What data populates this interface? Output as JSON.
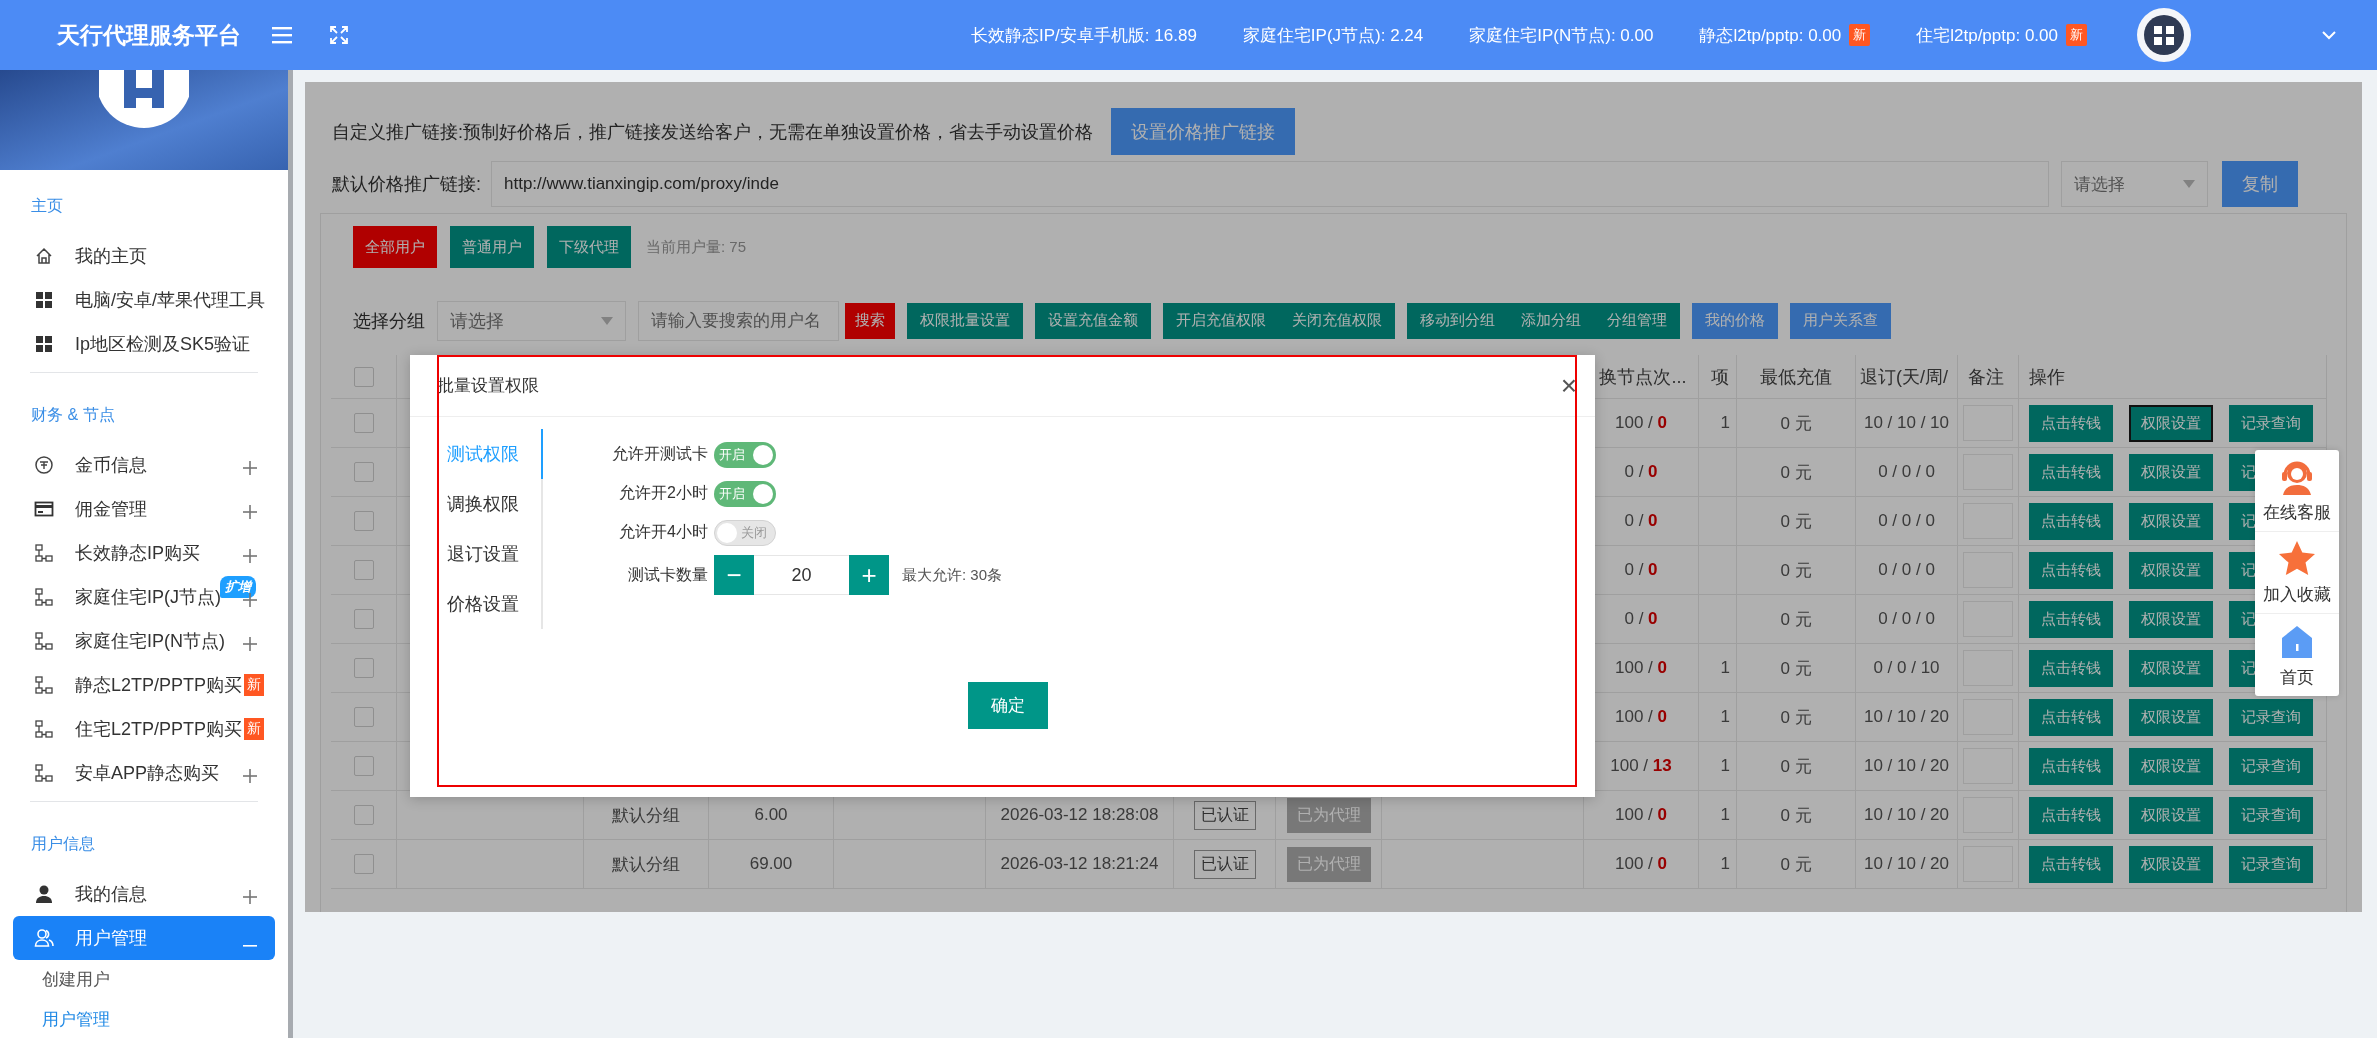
{
  "topbar": {
    "title": "天行代理服务平台",
    "stats": [
      {
        "label": "长效静态IP/安卓手机版: 16.89"
      },
      {
        "label": "家庭住宅IP(J节点): 2.24"
      },
      {
        "label": "家庭住宅IP(N节点): 0.00"
      },
      {
        "label": "静态l2tp/pptp: 0.00",
        "badge": "新"
      },
      {
        "label": "住宅l2tp/pptp: 0.00",
        "badge": "新"
      }
    ]
  },
  "sidebar": {
    "sections": [
      {
        "title": "主页",
        "items": [
          {
            "label": "我的主页",
            "selected": false
          },
          {
            "label": "电脑/安卓/苹果代理工具",
            "selected": false
          },
          {
            "label": "Ip地区检测及SK5验证",
            "selected": false
          }
        ]
      },
      {
        "title": "财务 & 节点",
        "items": [
          {
            "label": "金币信息",
            "selected": false,
            "expanded": false
          },
          {
            "label": "佣金管理",
            "selected": false,
            "expanded": false
          },
          {
            "label": "长效静态IP购买",
            "selected": false,
            "expanded": false
          },
          {
            "label": "家庭住宅IP(J节点)",
            "selected": false,
            "expanded": false,
            "badge": {
              "text": "扩增",
              "color": "#1e9fff"
            }
          },
          {
            "label": "家庭住宅IP(N节点)",
            "selected": false,
            "expanded": false
          },
          {
            "label": "静态L2TP/PPTP购买",
            "selected": false,
            "badge": {
              "text": "新",
              "color": "#ff5722"
            }
          },
          {
            "label": "住宅L2TP/PPTP购买",
            "selected": false,
            "badge": {
              "text": "新",
              "color": "#ff5722"
            }
          },
          {
            "label": "安卓APP静态购买",
            "selected": false,
            "expanded": false
          }
        ]
      },
      {
        "title": "用户信息",
        "items": [
          {
            "label": "我的信息",
            "selected": false,
            "expanded": false
          },
          {
            "label": "用户管理",
            "selected": true,
            "expanded": true,
            "children": [
              {
                "label": "创建用户",
                "selected": false
              },
              {
                "label": "用户管理",
                "selected": true
              }
            ]
          }
        ]
      }
    ]
  },
  "main": {
    "promo_text": "自定义推广链接:预制好价格后，推广链接发送给客户，无需在单独设置价格，省去手动设置价格",
    "promo_button": "设置价格推广链接",
    "link_label": "默认价格推广链接:",
    "link_value": "http://www.tianxingip.com/proxy/inde",
    "link_select": "请选择",
    "copy_button": "复制",
    "filters": [
      {
        "label": "全部用户",
        "selected": true
      },
      {
        "label": "普通用户",
        "selected": false
      },
      {
        "label": "下级代理",
        "selected": false
      }
    ],
    "user_count": "当前用户量: 75",
    "group_label": "选择分组",
    "group_select": "请选择",
    "search_placeholder": "请输入要搜索的用户名",
    "search_button": "搜索",
    "action_groups": [
      {
        "kind": "primary",
        "buttons": [
          "权限批量设置"
        ]
      },
      {
        "kind": "primary",
        "buttons": [
          "设置充值金额"
        ]
      },
      {
        "kind": "primary",
        "buttons": [
          "开启充值权限",
          "关闭充值权限"
        ]
      },
      {
        "kind": "primary",
        "buttons": [
          "移动到分组",
          "添加分组",
          "分组管理"
        ]
      },
      {
        "kind": "info",
        "buttons": [
          "我的价格"
        ]
      },
      {
        "kind": "info",
        "buttons": [
          "用户关系查"
        ]
      }
    ]
  },
  "table": {
    "select_all": false,
    "columns": [
      {
        "kind": "swap",
        "label": "换节点次..."
      },
      {
        "kind": "project",
        "label": "项"
      },
      {
        "kind": "min_recharge",
        "label": "最低充值"
      },
      {
        "kind": "unsubscribe",
        "label": "退订(天/周/"
      },
      {
        "kind": "note",
        "label": "备注"
      },
      {
        "kind": "actions",
        "label": "操作"
      }
    ],
    "rows": [
      {
        "checked": false,
        "swap": "100 / **0**",
        "project": "1",
        "min_recharge": "0 元",
        "unsubscribe": "10 / 10 / 10",
        "actions": [
          {
            "label": "点击转钱",
            "focused": false
          },
          {
            "label": "权限设置",
            "focused": true
          },
          {
            "label": "记录查询",
            "focused": false
          }
        ]
      },
      {
        "checked": false,
        "swap": "0 / **0**",
        "min_recharge": "0 元",
        "unsubscribe": "0 / 0 / 0",
        "actions": [
          {
            "label": "点击转钱",
            "focused": false
          },
          {
            "label": "权限设置",
            "focused": false
          },
          {
            "label": "记",
            "focused": false
          }
        ]
      },
      {
        "checked": false,
        "swap": "0 / **0**",
        "min_recharge": "0 元",
        "unsubscribe": "0 / 0 / 0",
        "actions": [
          {
            "label": "点击转钱",
            "focused": false
          },
          {
            "label": "权限设置",
            "focused": false
          },
          {
            "label": "记",
            "focused": false
          }
        ]
      },
      {
        "checked": false,
        "swap": "0 / **0**",
        "min_recharge": "0 元",
        "unsubscribe": "0 / 0 / 0",
        "actions": [
          {
            "label": "点击转钱",
            "focused": false
          },
          {
            "label": "权限设置",
            "focused": false
          },
          {
            "label": "记",
            "focused": false
          }
        ]
      },
      {
        "checked": false,
        "swap": "0 / **0**",
        "min_recharge": "0 元",
        "unsubscribe": "0 / 0 / 0",
        "actions": [
          {
            "label": "点击转钱",
            "focused": false
          },
          {
            "label": "权限设置",
            "focused": false
          },
          {
            "label": "记",
            "focused": false
          }
        ]
      },
      {
        "checked": false,
        "swap": "100 / **0**",
        "project": "1",
        "min_recharge": "0 元",
        "unsubscribe": "0 / 0 / 10",
        "actions": [
          {
            "label": "点击转钱",
            "focused": false
          },
          {
            "label": "权限设置",
            "focused": false
          },
          {
            "label": "记",
            "focused": false
          }
        ]
      },
      {
        "checked": false,
        "swap": "100 / **0**",
        "project": "1",
        "min_recharge": "0 元",
        "unsubscribe": "10 / 10 / 20",
        "actions": [
          {
            "label": "点击转钱",
            "focused": false
          },
          {
            "label": "权限设置",
            "focused": false
          },
          {
            "label": "记录查询",
            "focused": false
          }
        ]
      },
      {
        "checked": false,
        "swap": "100 / **13**",
        "project": "1",
        "min_recharge": "0 元",
        "unsubscribe": "10 / 10 / 20",
        "actions": [
          {
            "label": "点击转钱",
            "focused": false
          },
          {
            "label": "权限设置",
            "focused": false
          },
          {
            "label": "记录查询",
            "focused": false
          }
        ]
      },
      {
        "checked": false,
        "group": "默认分组",
        "balance": "6.00",
        "time": "2026-03-12 18:28:08",
        "verified": "已认证",
        "agent": "已为代理",
        "swap": "100 / **0**",
        "project": "1",
        "min_recharge": "0 元",
        "unsubscribe": "10 / 10 / 20",
        "actions": [
          {
            "label": "点击转钱",
            "focused": false
          },
          {
            "label": "权限设置",
            "focused": false
          },
          {
            "label": "记录查询",
            "focused": false
          }
        ]
      },
      {
        "checked": false,
        "group": "默认分组",
        "balance": "69.00",
        "time": "2026-03-12 18:21:24",
        "verified": "已认证",
        "agent": "已为代理",
        "swap": "100 / **0**",
        "project": "1",
        "min_recharge": "0 元",
        "unsubscribe": "10 / 10 / 20",
        "actions": [
          {
            "label": "点击转钱",
            "focused": false
          },
          {
            "label": "权限设置",
            "focused": false
          },
          {
            "label": "记录查询",
            "focused": false
          }
        ]
      }
    ]
  },
  "dialog": {
    "title": "批量设置权限",
    "close": "×",
    "tabs": [
      {
        "label": "测试权限",
        "selected": true
      },
      {
        "label": "调换权限",
        "selected": false
      },
      {
        "label": "退订设置",
        "selected": false
      },
      {
        "label": "价格设置",
        "selected": false
      }
    ],
    "toggles": [
      {
        "label": "允许开测试卡",
        "on": true,
        "text": "开启"
      },
      {
        "label": "允许开2小时",
        "on": true,
        "text": "开启"
      },
      {
        "label": "允许开4小时",
        "on": false,
        "text": "关闭"
      }
    ],
    "quantity": {
      "label": "测试卡数量",
      "minus": "−",
      "value": "20",
      "plus": "+",
      "hint": "最大允许: 30条"
    },
    "confirm": "确定"
  },
  "float_bar": {
    "items": [
      {
        "label": "在线客服"
      },
      {
        "label": "加入收藏"
      },
      {
        "label": "首页"
      }
    ]
  }
}
